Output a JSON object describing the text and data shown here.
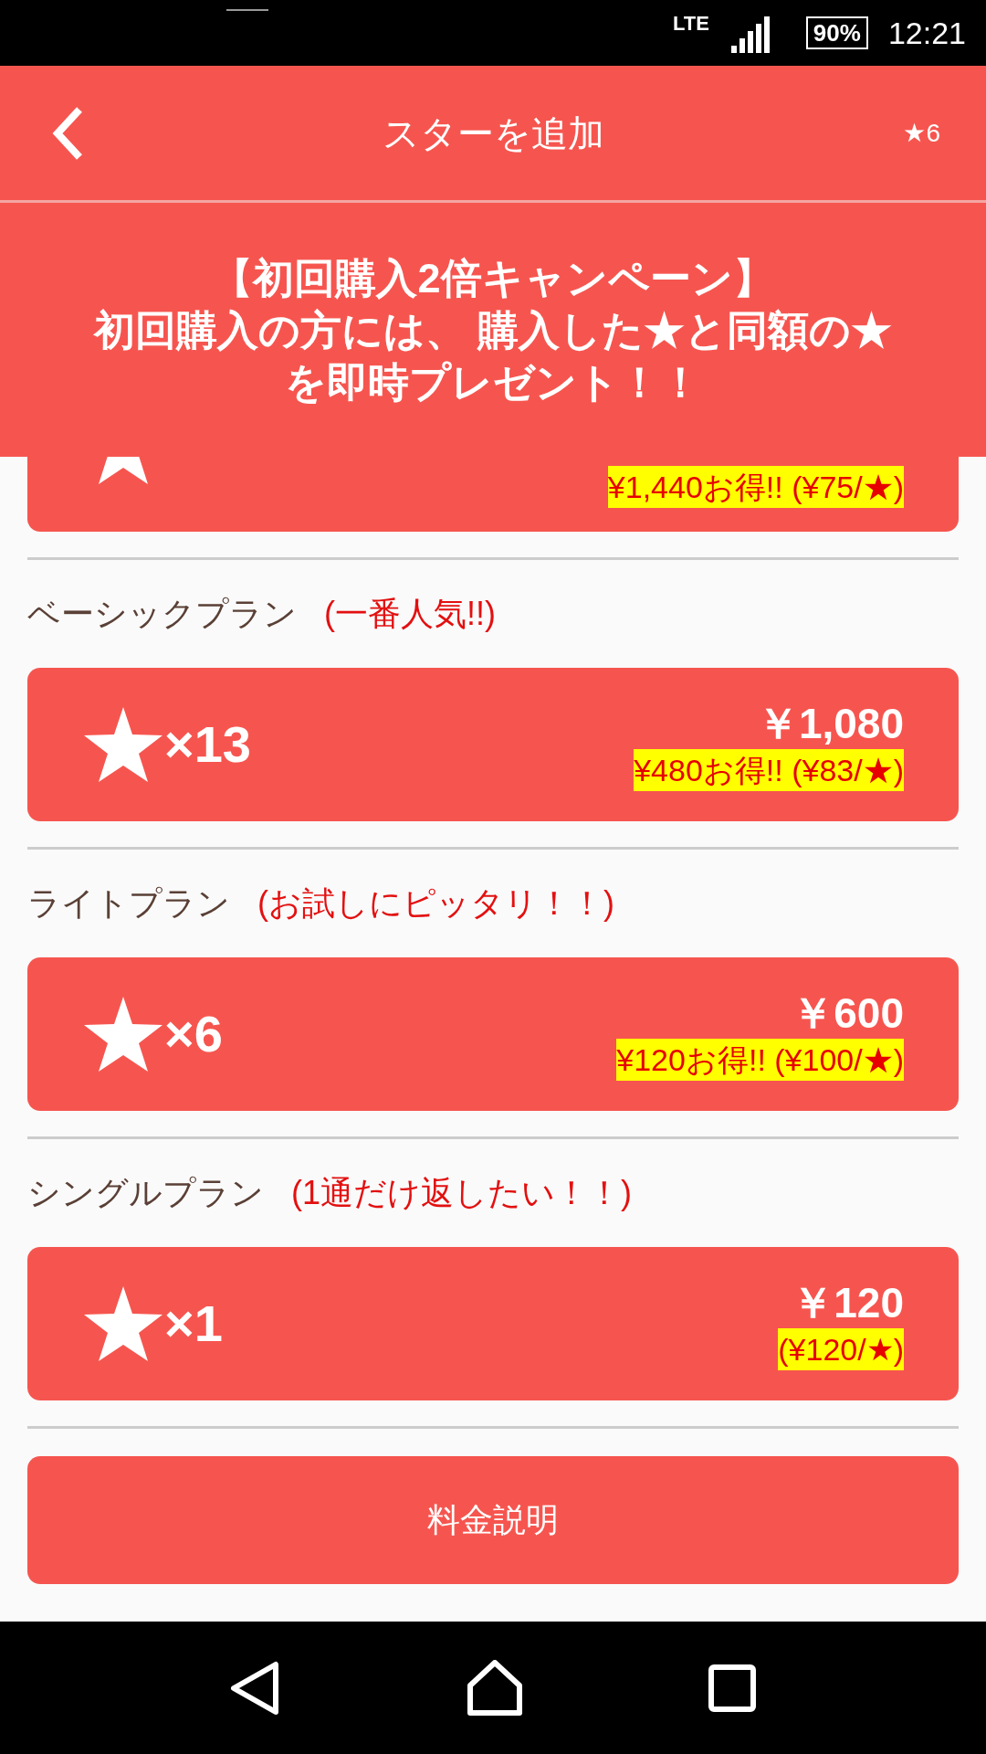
{
  "status_bar": {
    "network": "LTE",
    "battery": "90%",
    "time": "12:21"
  },
  "app_bar": {
    "title": "スターを追加",
    "star_count": "★6"
  },
  "banner": {
    "lines": [
      "【初回購入2倍キャンペーン】",
      "初回購入の方には、 購入した★と同額の★",
      "を即時プレゼント！！"
    ]
  },
  "plans": [
    {
      "saving": "¥1,440お得!! (¥75/★)"
    },
    {
      "name": "ベーシックプラン",
      "tagline": "(一番人気!!)",
      "count": "×13",
      "price": "￥1,080",
      "saving": "¥480お得!! (¥83/★)"
    },
    {
      "name": "ライトプラン",
      "tagline": "(お試しにピッタリ！！)",
      "count": "×6",
      "price": "￥600",
      "saving": "¥120お得!! (¥100/★)"
    },
    {
      "name": "シングルプラン",
      "tagline": "(1通だけ返したい！！)",
      "count": "×1",
      "price": "￥120",
      "saving": "(¥120/★)"
    }
  ],
  "fee_button": "料金説明"
}
